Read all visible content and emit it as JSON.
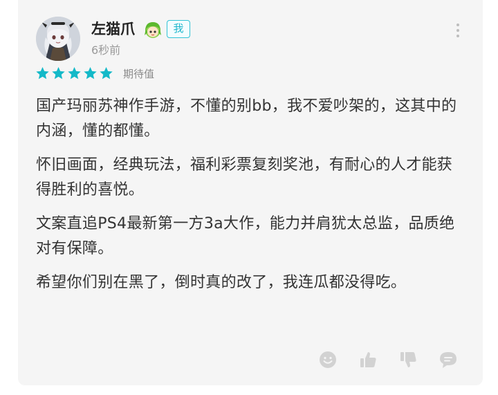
{
  "review": {
    "user": {
      "name": "左猫爪",
      "avatar_icon": "anime-girl-avatar",
      "badge_icon": "green-hair-character-icon",
      "me_badge": "我"
    },
    "timestamp": "6秒前",
    "rating": {
      "stars": 5,
      "max": 5,
      "star_color": "#14b9c8",
      "label": "期待值"
    },
    "paragraphs": [
      "国产玛丽苏神作手游，不懂的别bb，我不爱吵架的，这其中的内涵，懂的都懂。",
      "怀旧画面，经典玩法，福利彩票复刻奖池，有耐心的人才能获得胜利的喜悦。",
      "文案直追PS4最新第一方3a大作，能力并肩犹太总监，品质绝对有保障。",
      "希望你们别在黑了，倒时真的改了，我连瓜都没得吃。"
    ],
    "actions": [
      {
        "icon": "emoji-reaction-icon"
      },
      {
        "icon": "thumbs-up-icon"
      },
      {
        "icon": "thumbs-down-icon"
      },
      {
        "icon": "comment-icon"
      }
    ]
  }
}
